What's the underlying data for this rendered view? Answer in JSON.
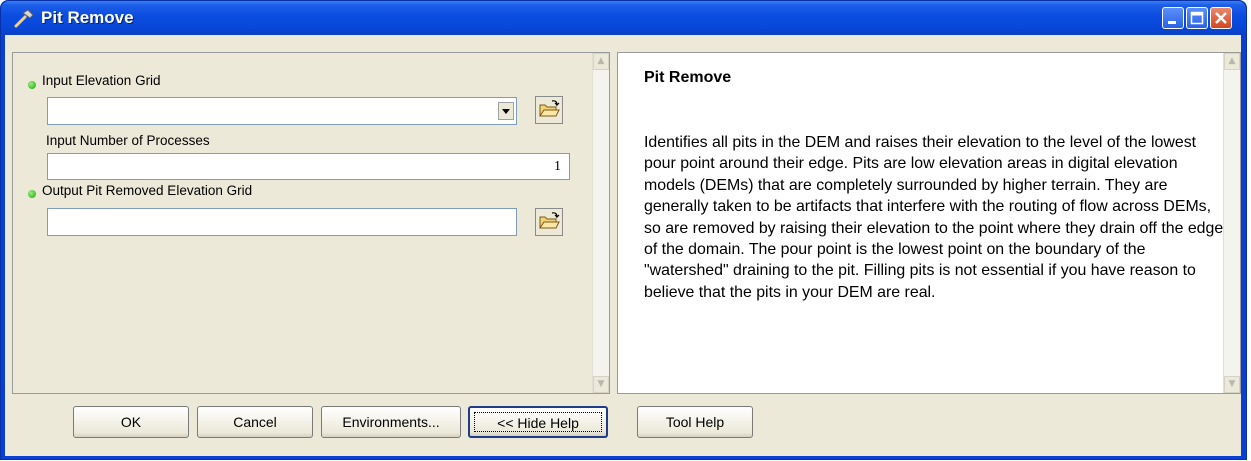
{
  "window": {
    "title": "Pit Remove"
  },
  "params": [
    {
      "label": "Input Elevation Grid",
      "required": true,
      "value": ""
    },
    {
      "label": "Input Number of Processes",
      "required": false,
      "value": "1"
    },
    {
      "label": "Output Pit Removed Elevation Grid",
      "required": true,
      "value": ""
    }
  ],
  "help": {
    "title": "Pit Remove",
    "text": "Identifies all pits in the DEM and raises their elevation to the level of the lowest pour point around their edge. Pits are low elevation areas in digital elevation models (DEMs) that are completely surrounded by higher terrain. They are generally taken to be artifacts that interfere with the routing of flow across DEMs, so are removed by raising their elevation to the point where they drain off the edge of the domain. The pour point is the lowest point on the boundary of the \"watershed\" draining to the pit. Filling pits is not essential if you have reason to believe that the pits in your DEM are real."
  },
  "buttons": {
    "ok": "OK",
    "cancel": "Cancel",
    "environments": "Environments...",
    "hide_help": "<< Hide Help",
    "tool_help": "Tool Help"
  },
  "colors": {
    "titlebar": "#0b4ce0",
    "required_dot": "#1aa30f",
    "dialog_bg": "#ece9d8"
  }
}
